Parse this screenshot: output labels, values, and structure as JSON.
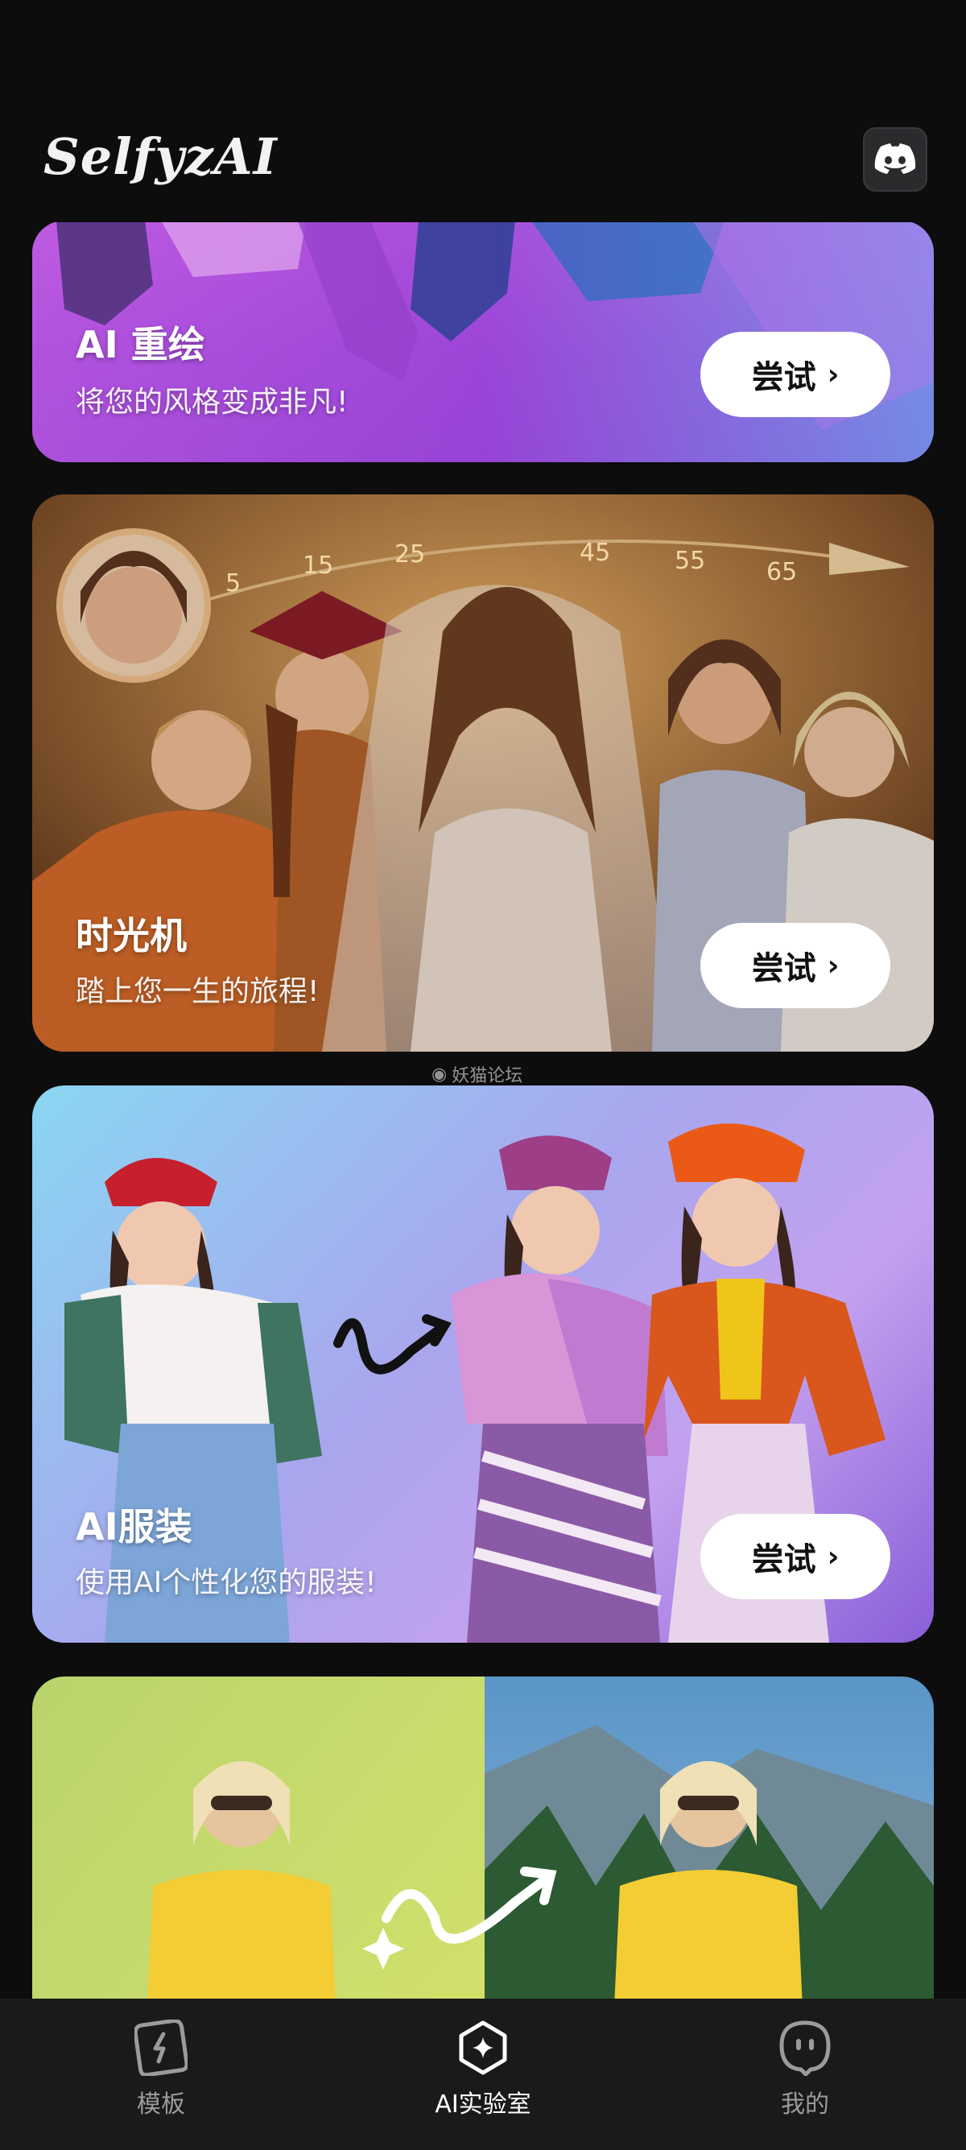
{
  "header": {
    "logo": "SelfyzAI",
    "discord_icon": "discord-icon"
  },
  "cards": [
    {
      "title": "AI 重绘",
      "subtitle": "将您的风格变成非凡!",
      "button": "尝试"
    },
    {
      "title": "时光机",
      "subtitle": "踏上您一生的旅程!",
      "button": "尝试",
      "dial_ticks": [
        "5",
        "15",
        "25",
        "45",
        "55",
        "65"
      ]
    },
    {
      "title": "AI服装",
      "subtitle": "使用AI个性化您的服装!",
      "button": "尝试"
    },
    {
      "title": "",
      "subtitle": "",
      "button": ""
    }
  ],
  "watermark": "妖猫论坛",
  "nav": [
    {
      "label": "模板",
      "icon": "template-icon"
    },
    {
      "label": "AI实验室",
      "icon": "ai-lab-icon"
    },
    {
      "label": "我的",
      "icon": "profile-icon"
    }
  ],
  "colors": {
    "background": "#0d0d0e",
    "nav_background": "#1a1a1b",
    "button_bg": "#ffffff"
  }
}
